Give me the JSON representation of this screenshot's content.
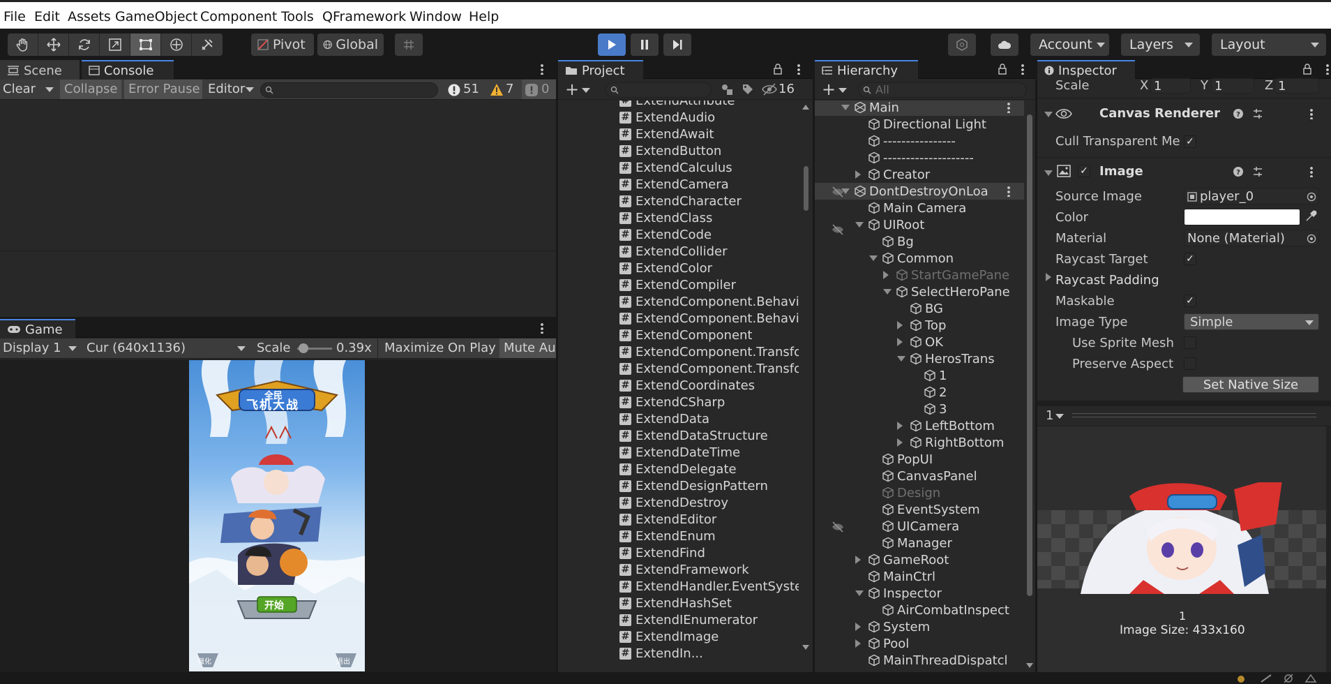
{
  "menu": [
    "File",
    "Edit",
    "Assets",
    "GameObject",
    "Component",
    "Tools",
    "QFramework",
    "Window",
    "Help"
  ],
  "toolbar": {
    "pivot_label": "Pivot",
    "global_label": "Global",
    "account_label": "Account",
    "layers_label": "Layers",
    "layout_label": "Layout"
  },
  "console": {
    "tab_scene": "Scene",
    "tab_console": "Console",
    "clear": "Clear",
    "collapse": "Collapse",
    "error_pause": "Error Pause",
    "editor": "Editor",
    "errors": "51",
    "warnings": "7",
    "infos": "0"
  },
  "game": {
    "tab": "Game",
    "display": "Display 1",
    "resolution": "Cur (640x1136)",
    "scale_label": "Scale",
    "scale_value": "0.39x",
    "maximize": "Maximize On Play",
    "mute": "Mute Au",
    "start_button": "开始",
    "title_top": "全民",
    "title_main": "飞机大战",
    "left_corner": "强化",
    "right_corner": "退出"
  },
  "project": {
    "tab": "Project",
    "hidden_count": "16",
    "items": [
      "ExtendAttribute",
      "ExtendAudio",
      "ExtendAwait",
      "ExtendButton",
      "ExtendCalculus",
      "ExtendCamera",
      "ExtendCharacter",
      "ExtendClass",
      "ExtendCode",
      "ExtendCollider",
      "ExtendColor",
      "ExtendCompiler",
      "ExtendComponent.Behavi",
      "ExtendComponent.Behavi",
      "ExtendComponent",
      "ExtendComponent.Transfo",
      "ExtendComponent.Transfo",
      "ExtendCoordinates",
      "ExtendCSharp",
      "ExtendData",
      "ExtendDataStructure",
      "ExtendDateTime",
      "ExtendDelegate",
      "ExtendDesignPattern",
      "ExtendDestroy",
      "ExtendEditor",
      "ExtendEnum",
      "ExtendFind",
      "ExtendFramework",
      "ExtendHandler.EventSyste",
      "ExtendHashSet",
      "ExtendIEnumerator",
      "ExtendImage",
      "ExtendIn..."
    ]
  },
  "hierarchy": {
    "tab": "Hierarchy",
    "search_placeholder": "All",
    "items": [
      {
        "label": "Main",
        "indent": 0,
        "type": "scene",
        "arrow": "down"
      },
      {
        "label": "Directional Light",
        "indent": 1,
        "type": "go",
        "arrow": ""
      },
      {
        "label": "----------------",
        "indent": 1,
        "type": "go",
        "arrow": ""
      },
      {
        "label": "--------------------",
        "indent": 1,
        "type": "go",
        "arrow": ""
      },
      {
        "label": "Creator",
        "indent": 1,
        "type": "go",
        "arrow": "right"
      },
      {
        "label": "DontDestroyOnLoa",
        "indent": 0,
        "type": "scene",
        "arrow": "down"
      },
      {
        "label": "Main Camera",
        "indent": 1,
        "type": "go",
        "arrow": ""
      },
      {
        "label": "UIRoot",
        "indent": 1,
        "type": "go",
        "arrow": "down"
      },
      {
        "label": "Bg",
        "indent": 2,
        "type": "go",
        "arrow": ""
      },
      {
        "label": "Common",
        "indent": 2,
        "type": "go",
        "arrow": "down"
      },
      {
        "label": "StartGamePane",
        "indent": 3,
        "type": "go",
        "arrow": "right",
        "dim": true
      },
      {
        "label": "SelectHeroPane",
        "indent": 3,
        "type": "go",
        "arrow": "down"
      },
      {
        "label": "BG",
        "indent": 4,
        "type": "go",
        "arrow": ""
      },
      {
        "label": "Top",
        "indent": 4,
        "type": "go",
        "arrow": "right"
      },
      {
        "label": "OK",
        "indent": 4,
        "type": "go",
        "arrow": "right"
      },
      {
        "label": "HerosTrans",
        "indent": 4,
        "type": "go",
        "arrow": "down"
      },
      {
        "label": "1",
        "indent": 5,
        "type": "go",
        "arrow": ""
      },
      {
        "label": "2",
        "indent": 5,
        "type": "go",
        "arrow": ""
      },
      {
        "label": "3",
        "indent": 5,
        "type": "go",
        "arrow": ""
      },
      {
        "label": "LeftBottom",
        "indent": 4,
        "type": "go",
        "arrow": "right"
      },
      {
        "label": "RightBottom",
        "indent": 4,
        "type": "go",
        "arrow": "right"
      },
      {
        "label": "PopUI",
        "indent": 2,
        "type": "go",
        "arrow": ""
      },
      {
        "label": "CanvasPanel",
        "indent": 2,
        "type": "go",
        "arrow": ""
      },
      {
        "label": "Design",
        "indent": 2,
        "type": "go",
        "arrow": "",
        "dim": true
      },
      {
        "label": "EventSystem",
        "indent": 2,
        "type": "go",
        "arrow": ""
      },
      {
        "label": "UICamera",
        "indent": 2,
        "type": "go",
        "arrow": ""
      },
      {
        "label": "Manager",
        "indent": 2,
        "type": "go",
        "arrow": ""
      },
      {
        "label": "GameRoot",
        "indent": 1,
        "type": "go",
        "arrow": "right"
      },
      {
        "label": "MainCtrl",
        "indent": 1,
        "type": "go",
        "arrow": ""
      },
      {
        "label": "Inspector",
        "indent": 1,
        "type": "go",
        "arrow": "down"
      },
      {
        "label": "AirCombatInspect",
        "indent": 2,
        "type": "go",
        "arrow": ""
      },
      {
        "label": "System",
        "indent": 1,
        "type": "go",
        "arrow": "right"
      },
      {
        "label": "Pool",
        "indent": 1,
        "type": "go",
        "arrow": "right"
      },
      {
        "label": "MainThreadDispatcl",
        "indent": 1,
        "type": "go",
        "arrow": ""
      }
    ]
  },
  "inspector": {
    "tab": "Inspector",
    "scale_label": "Scale",
    "scale_x_label": "X",
    "scale_x": "1",
    "scale_y_label": "Y",
    "scale_y": "1",
    "scale_z_label": "Z",
    "scale_z": "1",
    "canvas_renderer": "Canvas Renderer",
    "cull_label": "Cull Transparent Me",
    "image_title": "Image",
    "source_image_label": "Source Image",
    "source_image_value": "player_0",
    "color_label": "Color",
    "color_value": "#ffffff",
    "material_label": "Material",
    "material_value": "None (Material)",
    "raycast_target_label": "Raycast Target",
    "raycast_padding_label": "Raycast Padding",
    "maskable_label": "Maskable",
    "image_type_label": "Image Type",
    "image_type_value": "Simple",
    "use_sprite_mesh_label": "Use Sprite Mesh",
    "preserve_aspect_label": "Preserve Aspect",
    "set_native_size": "Set Native Size",
    "preview_selector": "1",
    "preview_name": "1",
    "image_size": "Image Size: 433x160"
  }
}
